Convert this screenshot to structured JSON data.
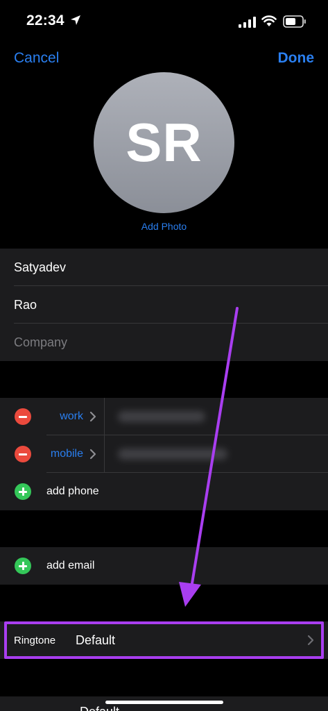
{
  "status_bar": {
    "time": "22:34"
  },
  "nav": {
    "cancel": "Cancel",
    "done": "Done"
  },
  "avatar": {
    "initials": "SR",
    "add_photo": "Add Photo"
  },
  "name_fields": {
    "first_name": "Satyadev",
    "last_name": "Rao",
    "company_placeholder": "Company"
  },
  "phones": [
    {
      "label": "work"
    },
    {
      "label": "mobile"
    }
  ],
  "add_phone": "add phone",
  "add_email": "add email",
  "ringtone": {
    "label": "Ringtone",
    "value": "Default"
  },
  "next_row": {
    "value": "Default"
  },
  "colors": {
    "accent": "#2a7ff0",
    "highlight": "#a93ef0",
    "remove": "#eb4a3d",
    "add": "#34c759"
  }
}
